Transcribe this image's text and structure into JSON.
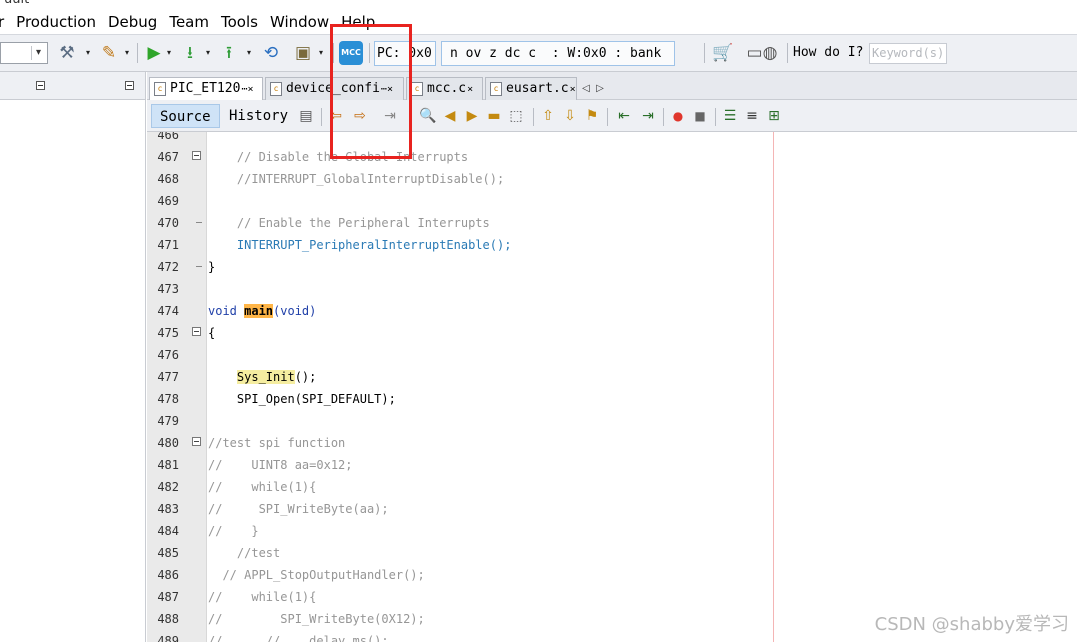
{
  "menu": [
    "r",
    "Production",
    "Debug",
    "Team",
    "Tools",
    "Window",
    "Help"
  ],
  "toolbar": {
    "pc_label": "PC: 0x0",
    "status_text": "n ov z dc c  : W:0x0 : bank",
    "mcc_label": "MCC",
    "howdoi_label": "How do I?",
    "keyword_placeholder": "Keyword(s)"
  },
  "tabs": [
    {
      "label": "PIC_ET120",
      "close": "⋯×"
    },
    {
      "label": "device_confi",
      "close": "⋯×"
    },
    {
      "label": "mcc.c",
      "close": "×"
    },
    {
      "label": "eusart.c",
      "close": "×"
    }
  ],
  "editor_modes": {
    "source": "Source",
    "history": "History"
  },
  "code_lines": [
    {
      "n": "466",
      "t": ""
    },
    {
      "n": "467",
      "t": "    // Disable the Global Interrupts"
    },
    {
      "n": "468",
      "t": "    //INTERRUPT_GlobalInterruptDisable();"
    },
    {
      "n": "469",
      "t": ""
    },
    {
      "n": "470",
      "t": "    // Enable the Peripheral Interrupts"
    },
    {
      "n": "471",
      "t": "    INTERRUPT_PeripheralInterruptEnable();"
    },
    {
      "n": "472",
      "t": "}"
    },
    {
      "n": "473",
      "t": ""
    },
    {
      "n": "474",
      "t": "void main(void)"
    },
    {
      "n": "475",
      "t": "{"
    },
    {
      "n": "476",
      "t": ""
    },
    {
      "n": "477",
      "t": "    Sys_Init();"
    },
    {
      "n": "478",
      "t": "    SPI_Open(SPI_DEFAULT);"
    },
    {
      "n": "479",
      "t": ""
    },
    {
      "n": "480",
      "t": "//test spi function"
    },
    {
      "n": "481",
      "t": "//    UINT8 aa=0x12;"
    },
    {
      "n": "482",
      "t": "//    while(1){"
    },
    {
      "n": "483",
      "t": "//     SPI_WriteByte(aa);"
    },
    {
      "n": "484",
      "t": "//    }"
    },
    {
      "n": "485",
      "t": "    //test"
    },
    {
      "n": "486",
      "t": "  // APPL_StopOutputHandler();"
    },
    {
      "n": "487",
      "t": "//    while(1){"
    },
    {
      "n": "488",
      "t": "//        SPI_WriteByte(0X12);"
    },
    {
      "n": "489",
      "t": "//      //    delay_ms();"
    }
  ],
  "watermark": "CSDN @shabby爱学习",
  "colors": {
    "highlight_box": "#e8231f",
    "comment": "#969696",
    "function": "#2a7ab5",
    "keyword": "#1f3fa8"
  }
}
